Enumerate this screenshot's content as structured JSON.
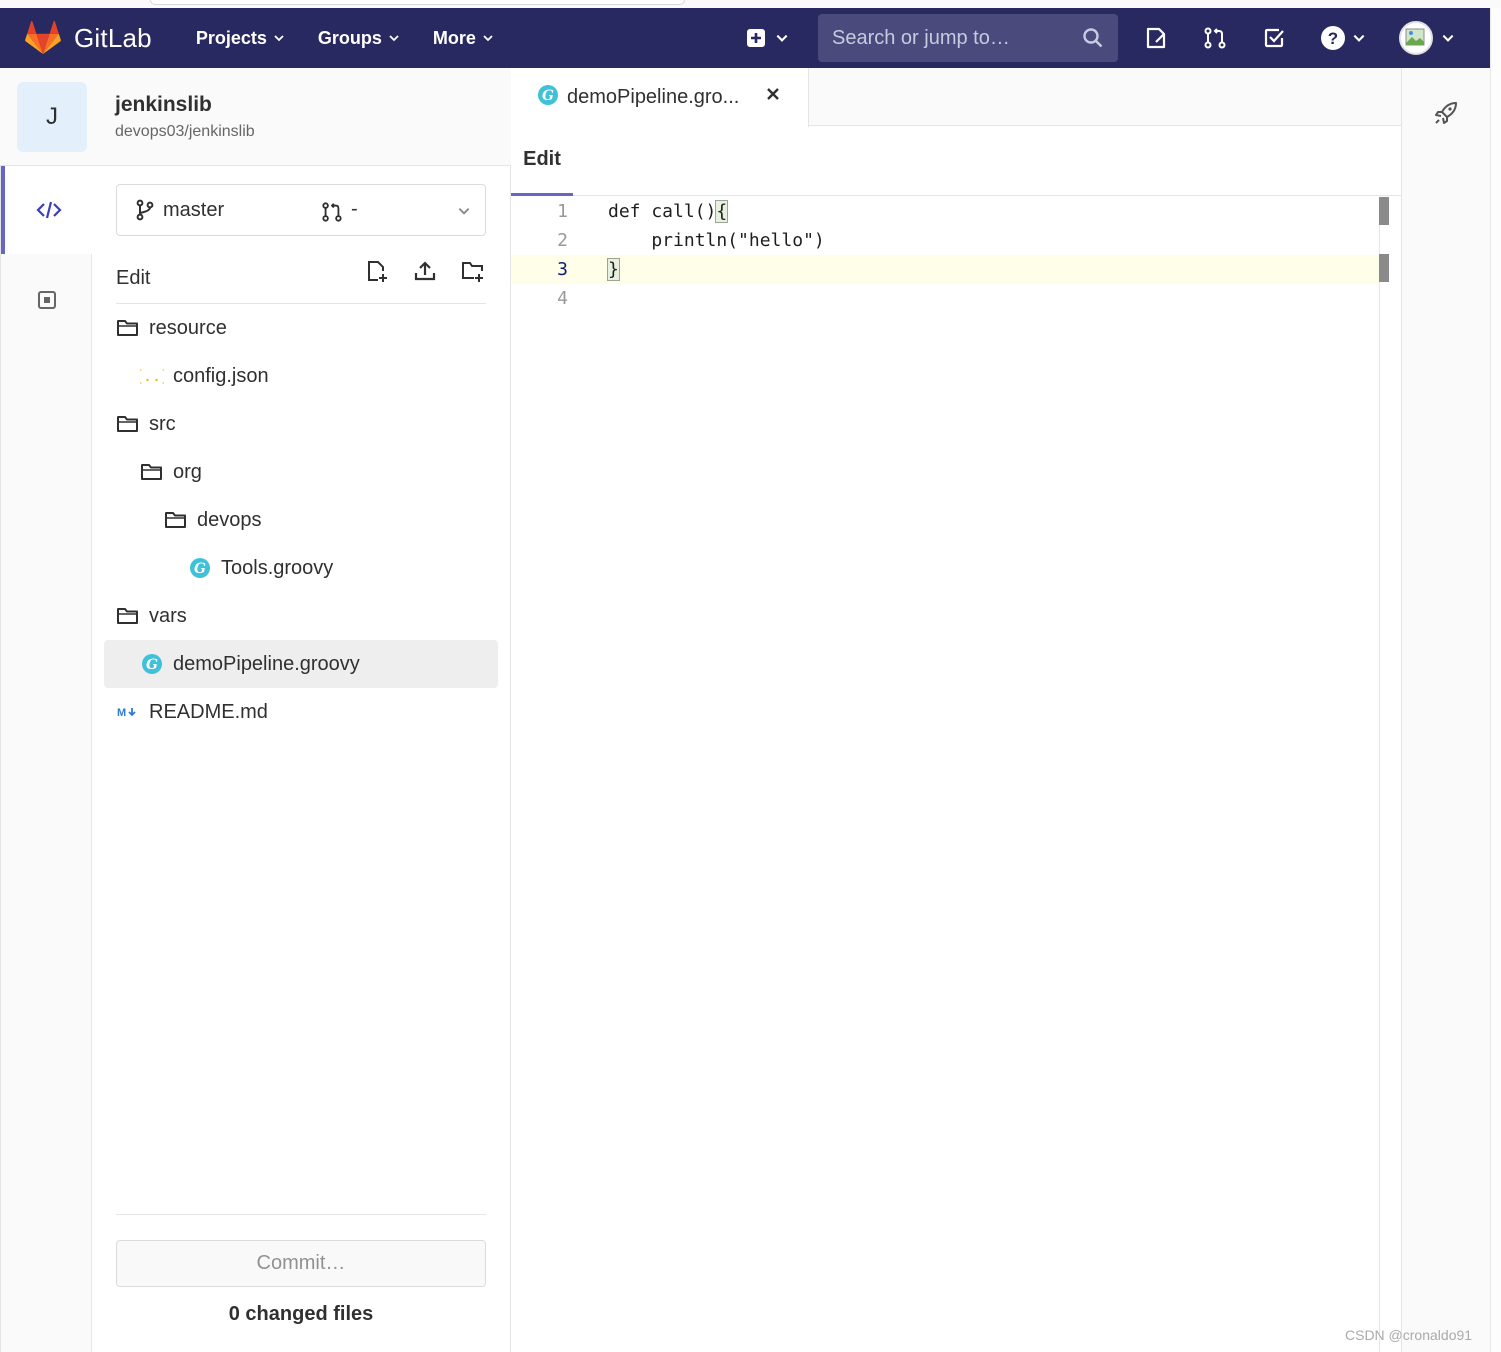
{
  "navbar": {
    "brand": "GitLab",
    "menu": [
      "Projects",
      "Groups",
      "More"
    ],
    "search_placeholder": "Search or jump to…",
    "bg_color": "#292961"
  },
  "project": {
    "avatar_letter": "J",
    "name": "jenkinslib",
    "path": "devops03/jenkinslib"
  },
  "branch": {
    "name": "master",
    "merge_request": "-"
  },
  "tree_header": {
    "edit_label": "Edit"
  },
  "tree": [
    {
      "label": "resource",
      "type": "folder",
      "depth": 0
    },
    {
      "label": "config.json",
      "type": "json",
      "depth": 1
    },
    {
      "label": "src",
      "type": "folder",
      "depth": 0
    },
    {
      "label": "org",
      "type": "folder",
      "depth": 1
    },
    {
      "label": "devops",
      "type": "folder",
      "depth": 2
    },
    {
      "label": "Tools.groovy",
      "type": "groovy",
      "depth": 3
    },
    {
      "label": "vars",
      "type": "folder",
      "depth": 0
    },
    {
      "label": "demoPipeline.groovy",
      "type": "groovy",
      "depth": 1,
      "selected": true
    },
    {
      "label": "README.md",
      "type": "markdown",
      "depth": 0
    }
  ],
  "footer": {
    "commit_label": "Commit…",
    "changed_files": "0 changed files"
  },
  "editor": {
    "tab_label": "demoPipeline.gro...",
    "mode_label": "Edit",
    "current_line": 3,
    "lines": [
      {
        "num": "1",
        "text": "def call(){"
      },
      {
        "num": "2",
        "text": "    println(\"hello\")"
      },
      {
        "num": "3",
        "text": "}"
      },
      {
        "num": "4",
        "text": ""
      }
    ]
  },
  "watermark": "CSDN @cronaldo91",
  "colors": {
    "accent": "#6666c4",
    "groovy": "#3fc1d7",
    "json": "#e7b416",
    "markdown": "#2e7bd6"
  }
}
